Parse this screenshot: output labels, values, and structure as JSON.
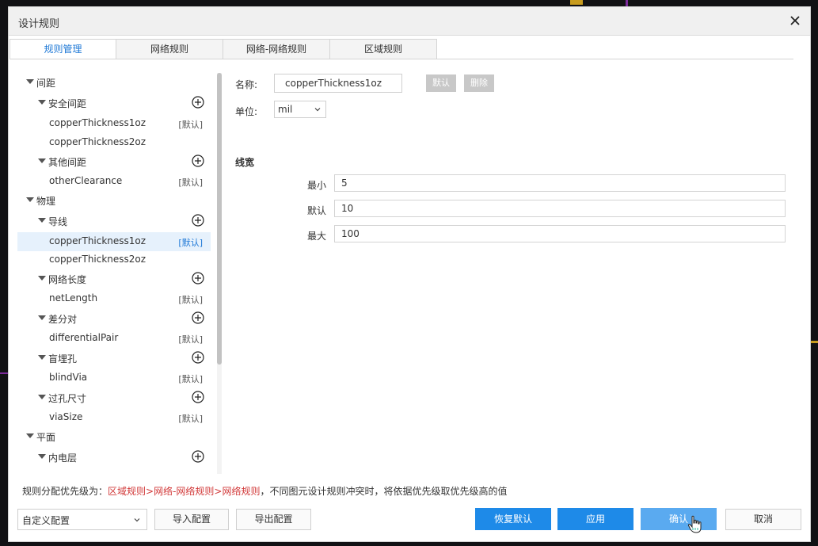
{
  "window": {
    "title": "设计规则"
  },
  "tabs": [
    {
      "label": "规则管理",
      "active": true
    },
    {
      "label": "网络规则",
      "active": false
    },
    {
      "label": "网络-网络规则",
      "active": false
    },
    {
      "label": "区域规则",
      "active": false
    }
  ],
  "tree": {
    "default_tag": "[默认]",
    "nodes": [
      {
        "label": "间距",
        "level": 0
      },
      {
        "label": "安全间距",
        "level": 1,
        "add": true
      },
      {
        "label": "copperThickness1oz",
        "level": 2,
        "tag": "[默认]"
      },
      {
        "label": "copperThickness2oz",
        "level": 2
      },
      {
        "label": "其他间距",
        "level": 1,
        "add": true
      },
      {
        "label": "otherClearance",
        "level": 2,
        "tag": "[默认]"
      },
      {
        "label": "物理",
        "level": 0
      },
      {
        "label": "导线",
        "level": 1,
        "add": true
      },
      {
        "label": "copperThickness1oz",
        "level": 2,
        "tag": "[默认]",
        "selected": true
      },
      {
        "label": "copperThickness2oz",
        "level": 2
      },
      {
        "label": "网络长度",
        "level": 1,
        "add": true
      },
      {
        "label": "netLength",
        "level": 2,
        "tag": "[默认]"
      },
      {
        "label": "差分对",
        "level": 1,
        "add": true
      },
      {
        "label": "differentialPair",
        "level": 2,
        "tag": "[默认]"
      },
      {
        "label": "盲埋孔",
        "level": 1,
        "add": true
      },
      {
        "label": "blindVia",
        "level": 2,
        "tag": "[默认]"
      },
      {
        "label": "过孔尺寸",
        "level": 1,
        "add": true
      },
      {
        "label": "viaSize",
        "level": 2,
        "tag": "[默认]"
      },
      {
        "label": "平面",
        "level": 0
      },
      {
        "label": "内电层",
        "level": 1,
        "add": true
      }
    ]
  },
  "detail": {
    "name_label": "名称:",
    "name_value": "copperThickness1oz",
    "default_btn": "默认",
    "delete_btn": "删除",
    "unit_label": "单位:",
    "unit_value": "mil",
    "section": "线宽",
    "min_label": "最小",
    "min_value": "5",
    "default_label": "默认",
    "default_value": "10",
    "max_label": "最大",
    "max_value": "100"
  },
  "priority": {
    "prefix": "规则分配优先级为：",
    "order": "区域规则>网络-网络规则>网络规则",
    "suffix": "，不同图元设计规则冲突时，将依据优先级取优先级高的值"
  },
  "footer": {
    "config_select": "自定义配置",
    "import_btn": "导入配置",
    "export_btn": "导出配置",
    "restore_btn": "恢复默认",
    "apply_btn": "应用",
    "confirm_btn": "确认",
    "cancel_btn": "取消"
  },
  "colors": {
    "accent": "#1e8ae8",
    "accent_hover": "#5aaaf0",
    "priority_red": "#d23a3a",
    "tab_active": "#1e78d6"
  }
}
